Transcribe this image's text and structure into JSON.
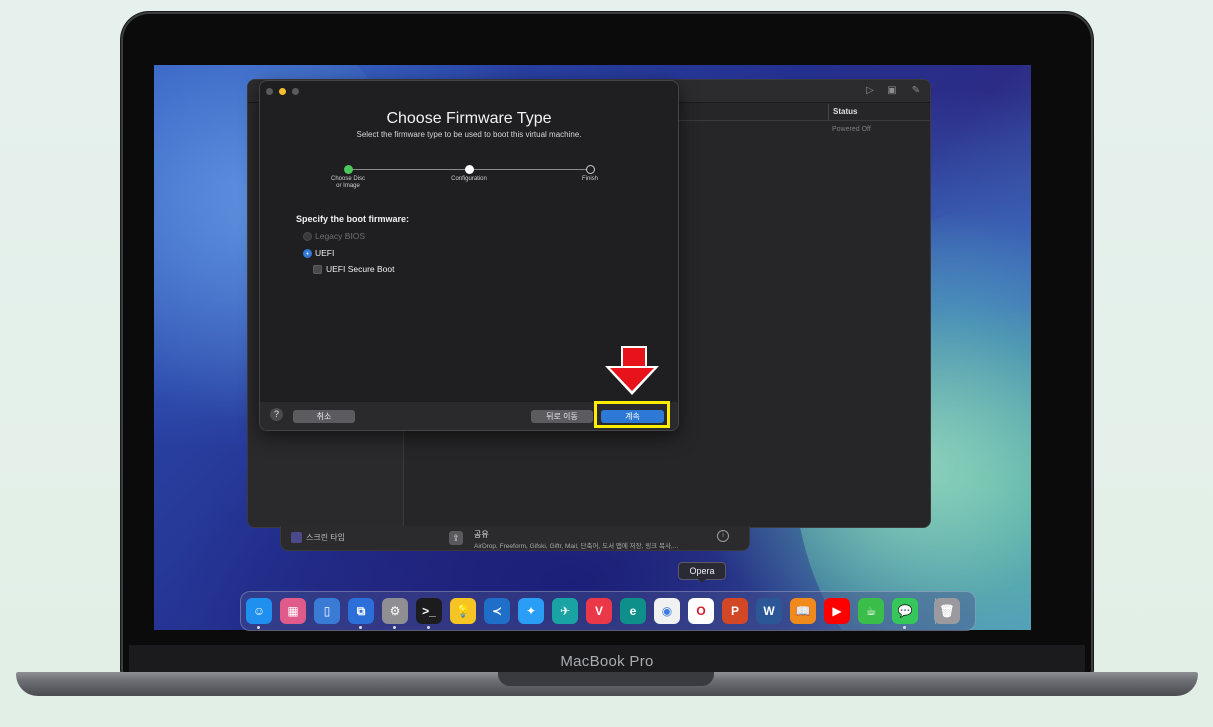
{
  "device": {
    "model_label": "MacBook Pro"
  },
  "vm_window": {
    "status_header": "Status",
    "status_value": "Powered Off"
  },
  "settings_behind": {
    "screen_time_label": "스크린 타임",
    "share_title": "공유",
    "share_subtitle": "AirDrop, Freeform, Gifski, Giftr, Mail, 단축어, 도서 앱에 저장, 링크 복사,..."
  },
  "dialog": {
    "title": "Choose Firmware Type",
    "subtitle": "Select the firmware type to be used to boot this virtual machine.",
    "steps": [
      {
        "label": "Choose Disc\nor Image",
        "state": "done",
        "color": "#4cc75a"
      },
      {
        "label": "Configuration",
        "state": "current",
        "color": "#ffffff"
      },
      {
        "label": "Finish",
        "state": "pending",
        "color": "#1f1f21"
      }
    ],
    "section_title": "Specify the boot firmware:",
    "options": {
      "legacy_bios": {
        "label": "Legacy BIOS",
        "selected": false,
        "disabled": true
      },
      "uefi": {
        "label": "UEFI",
        "selected": true
      },
      "uefi_secure_boot": {
        "label": "UEFI Secure Boot",
        "checked": false
      }
    },
    "buttons": {
      "help": "?",
      "cancel": "취소",
      "back": "뒤로 이동",
      "continue": "계속"
    }
  },
  "annotation": {
    "highlight_color": "#ffee00",
    "arrow_color": "#e8121a"
  },
  "dock": {
    "tooltip": "Opera",
    "apps": [
      {
        "name": "Finder",
        "icon": "finder-icon",
        "glyph": "☺",
        "color": "#1f8ff0",
        "running": true
      },
      {
        "name": "Launchpad",
        "icon": "launchpad-icon",
        "glyph": "▦",
        "color": "#e05a8a",
        "running": false
      },
      {
        "name": "iPhone Mirroring",
        "icon": "phone-icon",
        "glyph": "▯",
        "color": "#3a7bd5",
        "running": false
      },
      {
        "name": "Parallels",
        "icon": "vm-app-icon",
        "glyph": "⧉",
        "color": "#2d6fd8",
        "running": true
      },
      {
        "name": "System Settings",
        "icon": "gear-icon",
        "glyph": "⚙",
        "color": "#8e8e93",
        "running": true
      },
      {
        "name": "Terminal",
        "icon": "terminal-icon",
        "glyph": ">_",
        "color": "#1c1c1e",
        "running": true
      },
      {
        "name": "Tips",
        "icon": "lightbulb-icon",
        "glyph": "💡",
        "color": "#f7c523",
        "running": false
      },
      {
        "name": "VS Code",
        "icon": "code-editor-icon",
        "glyph": "≺",
        "color": "#1f6fc9",
        "running": false
      },
      {
        "name": "Safari",
        "icon": "compass-icon",
        "glyph": "✦",
        "color": "#2a9df4",
        "running": false
      },
      {
        "name": "Swift",
        "icon": "bird-icon",
        "glyph": "✈",
        "color": "#1aa3a3",
        "running": false
      },
      {
        "name": "Vivaldi",
        "icon": "vivaldi-icon",
        "glyph": "V",
        "color": "#ea3848",
        "running": false
      },
      {
        "name": "Edge",
        "icon": "edge-icon",
        "glyph": "e",
        "color": "#0f8f8a",
        "running": false
      },
      {
        "name": "Chrome",
        "icon": "chrome-icon",
        "glyph": "◉",
        "color": "#f1f1f1",
        "running": false
      },
      {
        "name": "Opera",
        "icon": "opera-icon",
        "glyph": "O",
        "color": "#ffffff",
        "running": false
      },
      {
        "name": "PowerPoint",
        "icon": "powerpoint-icon",
        "glyph": "P",
        "color": "#d24726",
        "running": false
      },
      {
        "name": "Word",
        "icon": "word-icon",
        "glyph": "W",
        "color": "#2b5797",
        "running": false
      },
      {
        "name": "Books",
        "icon": "book-icon",
        "glyph": "📖",
        "color": "#f08a1c",
        "running": false
      },
      {
        "name": "YouTube",
        "icon": "play-icon",
        "glyph": "▶",
        "color": "#ff0000",
        "running": false
      },
      {
        "name": "Cup",
        "icon": "cup-icon",
        "glyph": "☕",
        "color": "#3bbd4a",
        "running": false
      },
      {
        "name": "Messages",
        "icon": "chat-bubble-icon",
        "glyph": "💬",
        "color": "#35c759",
        "running": true
      },
      {
        "name": "Trash",
        "icon": "trash-icon",
        "glyph": "🗑",
        "color": "#9a9a9f",
        "running": false
      }
    ]
  }
}
